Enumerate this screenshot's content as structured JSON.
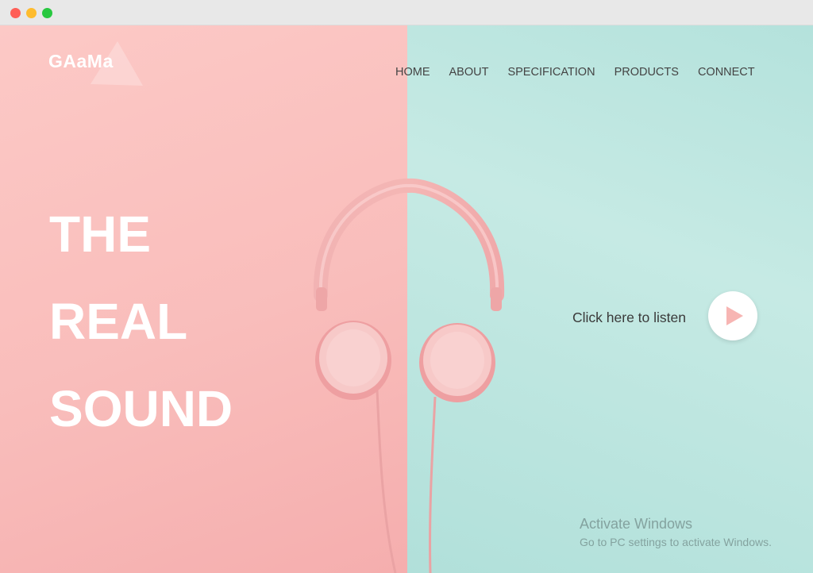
{
  "brand": {
    "logo": "GAaMa"
  },
  "nav": {
    "items": [
      "HOME",
      "ABOUT",
      "SPECIFICATION",
      "PRODUCTS",
      "CONNECT"
    ]
  },
  "hero": {
    "headline": [
      "THE",
      "REAL",
      "SOUND"
    ],
    "listen_label": "Click here to listen"
  },
  "activation": {
    "title": "Activate Windows",
    "subtitle": "Go to PC settings to activate Windows."
  },
  "colors": {
    "left_pane": "#f9bdbb",
    "right_pane": "#c6eae4",
    "play_icon": "#f7b5b3"
  }
}
